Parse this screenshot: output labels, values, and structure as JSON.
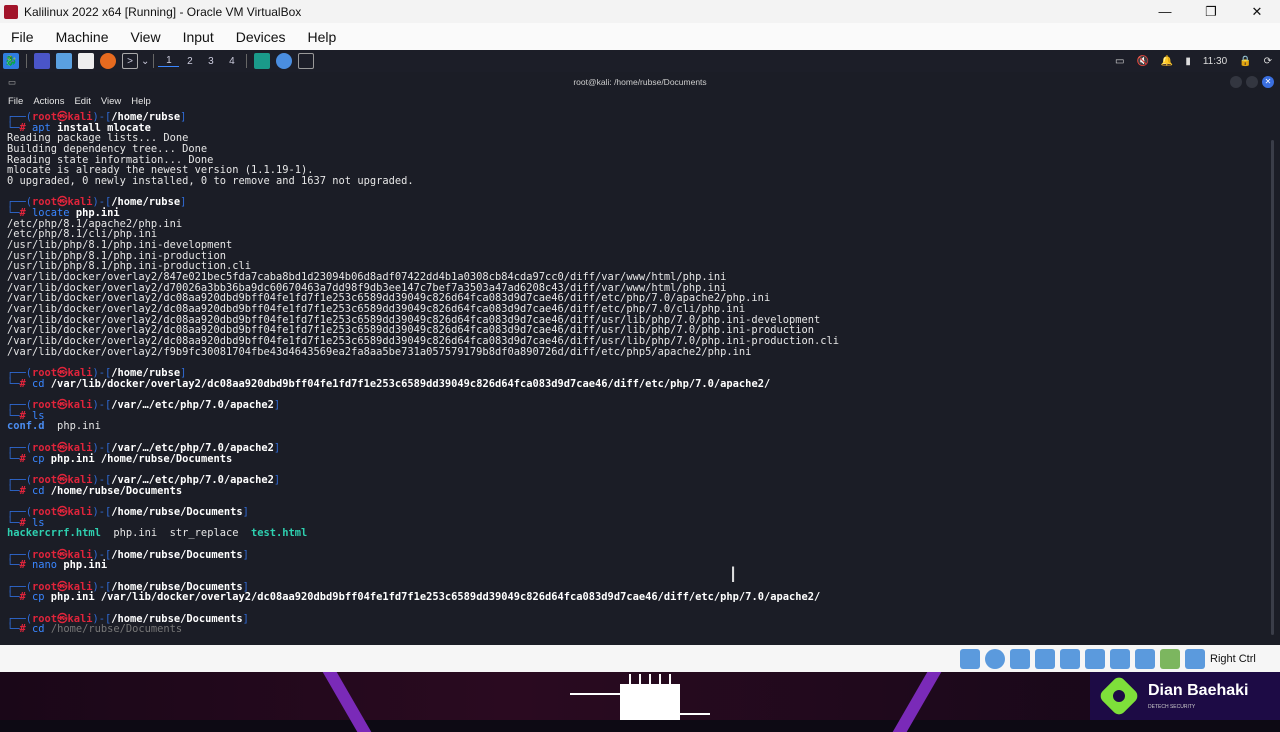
{
  "window": {
    "title": "Kalilinux 2022 x64 [Running] - Oracle VM VirtualBox",
    "minimize": "—",
    "maximize": "❐",
    "close": "✕"
  },
  "menu": [
    "File",
    "Machine",
    "View",
    "Input",
    "Devices",
    "Help"
  ],
  "panel": {
    "workspaces": [
      "1",
      "2",
      "3",
      "4"
    ],
    "clock": "11:30"
  },
  "terminal": {
    "title": "root@kali: /home/rubse/Documents",
    "menu": [
      "File",
      "Actions",
      "Edit",
      "View",
      "Help"
    ],
    "user": "root",
    "host": "kali",
    "lines": [
      {
        "p": "/home/rubse",
        "c": "apt",
        "a": " install mlocate"
      },
      {
        "o": "Reading package lists... Done"
      },
      {
        "o": "Building dependency tree... Done"
      },
      {
        "o": "Reading state information... Done"
      },
      {
        "o": "mlocate is already the newest version (1.1.19-1)."
      },
      {
        "o": "0 upgraded, 0 newly installed, 0 to remove and 1637 not upgraded."
      },
      {
        "o": ""
      },
      {
        "p": "/home/rubse",
        "c": "locate",
        "a": " php.ini"
      },
      {
        "o": "/etc/php/8.1/apache2/php.ini"
      },
      {
        "o": "/etc/php/8.1/cli/php.ini"
      },
      {
        "o": "/usr/lib/php/8.1/php.ini-development"
      },
      {
        "o": "/usr/lib/php/8.1/php.ini-production"
      },
      {
        "o": "/usr/lib/php/8.1/php.ini-production.cli"
      },
      {
        "o": "/var/lib/docker/overlay2/847e021bec5fda7caba8bd1d23094b06d8adf07422dd4b1a0308cb84cda97cc0/diff/var/www/html/php.ini"
      },
      {
        "o": "/var/lib/docker/overlay2/d70026a3bb36ba9dc60670463a7dd98f9db3ee147c7bef7a3503a47ad6208c43/diff/var/www/html/php.ini"
      },
      {
        "o": "/var/lib/docker/overlay2/dc08aa920dbd9bff04fe1fd7f1e253c6589dd39049c826d64fca083d9d7cae46/diff/etc/php/7.0/apache2/php.ini"
      },
      {
        "o": "/var/lib/docker/overlay2/dc08aa920dbd9bff04fe1fd7f1e253c6589dd39049c826d64fca083d9d7cae46/diff/etc/php/7.0/cli/php.ini"
      },
      {
        "o": "/var/lib/docker/overlay2/dc08aa920dbd9bff04fe1fd7f1e253c6589dd39049c826d64fca083d9d7cae46/diff/usr/lib/php/7.0/php.ini-development"
      },
      {
        "o": "/var/lib/docker/overlay2/dc08aa920dbd9bff04fe1fd7f1e253c6589dd39049c826d64fca083d9d7cae46/diff/usr/lib/php/7.0/php.ini-production"
      },
      {
        "o": "/var/lib/docker/overlay2/dc08aa920dbd9bff04fe1fd7f1e253c6589dd39049c826d64fca083d9d7cae46/diff/usr/lib/php/7.0/php.ini-production.cli"
      },
      {
        "o": "/var/lib/docker/overlay2/f9b9fc30081704fbe43d4643569ea2fa8aa5be731a057579179b8df0a890726d/diff/etc/php5/apache2/php.ini"
      },
      {
        "o": ""
      },
      {
        "p": "/home/rubse",
        "c": "cd",
        "a": " /var/lib/docker/overlay2/dc08aa920dbd9bff04fe1fd7f1e253c6589dd39049c826d64fca083d9d7cae46/diff/etc/php/7.0/apache2/"
      },
      {
        "o": ""
      },
      {
        "p": "/var/…/etc/php/7.0/apache2",
        "c": "ls",
        "a": ""
      },
      {
        "f": [
          {
            "t": "conf.d",
            "k": "blue"
          },
          {
            "t": "  php.ini",
            "k": ""
          }
        ]
      },
      {
        "o": ""
      },
      {
        "p": "/var/…/etc/php/7.0/apache2",
        "c": "cp",
        "a": " php.ini /home/rubse/Documents"
      },
      {
        "o": ""
      },
      {
        "p": "/var/…/etc/php/7.0/apache2",
        "c": "cd",
        "a": " /home/rubse/Documents"
      },
      {
        "o": ""
      },
      {
        "p": "/home/rubse/Documents",
        "c": "ls",
        "a": ""
      },
      {
        "f": [
          {
            "t": "hackercrrf.html",
            "k": "teal"
          },
          {
            "t": "  php.ini  str_replace  ",
            "k": ""
          },
          {
            "t": "test.html",
            "k": "teal"
          }
        ]
      },
      {
        "o": ""
      },
      {
        "p": "/home/rubse/Documents",
        "c": "nano",
        "a": " php.ini"
      },
      {
        "o": ""
      },
      {
        "p": "/home/rubse/Documents",
        "c": "cp",
        "a": " php.ini /var/lib/docker/overlay2/dc08aa920dbd9bff04fe1fd7f1e253c6589dd39049c826d64fca083d9d7cae46/diff/etc/php/7.0/apache2/"
      },
      {
        "o": ""
      },
      {
        "p": "/home/rubse/Documents",
        "c": "cd",
        "a": " ",
        "s": "/home/rubse/Documents"
      }
    ]
  },
  "branding": {
    "name": "Dian Baehaki",
    "sub": "DETECH SECURITY",
    "status_text": "Right Ctrl"
  }
}
